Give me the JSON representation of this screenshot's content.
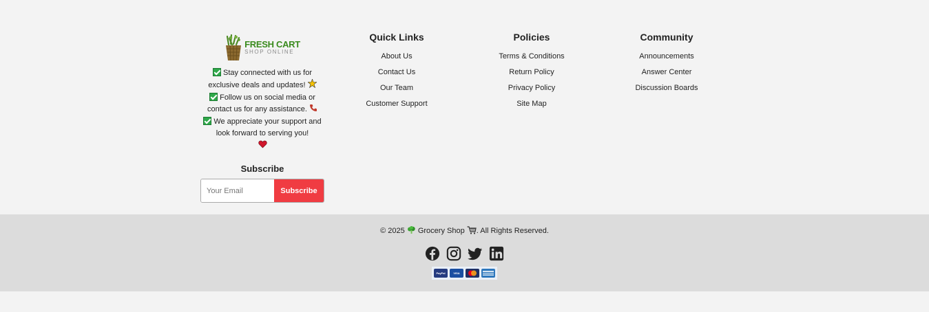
{
  "brand": {
    "logo_line1": "FRESH CART",
    "logo_line2": "SHOP ONLINE",
    "intro": [
      {
        "text": "Stay connected with us for exclusive deals and updates!",
        "emoji": "sparkle-icon"
      },
      {
        "text": "Follow us on social media or contact us for any assistance.",
        "emoji": "phone-icon"
      },
      {
        "text": "We appreciate your support and look forward to serving you!",
        "emoji": "heart-icon"
      }
    ]
  },
  "subscribe": {
    "title": "Subscribe",
    "placeholder": "Your Email",
    "button_label": "Subscribe",
    "button_color": "#f03c42"
  },
  "quick_links": {
    "title": "Quick Links",
    "items": [
      "About Us",
      "Contact Us",
      "Our Team",
      "Customer Support"
    ]
  },
  "policies": {
    "title": "Policies",
    "items": [
      "Terms & Conditions",
      "Return Policy",
      "Privacy Policy",
      "Site Map"
    ]
  },
  "community": {
    "title": "Community",
    "items": [
      "Announcements",
      "Answer Center",
      "Discussion Boards"
    ]
  },
  "bottom": {
    "copyright_prefix": "© 2025",
    "copyright_name": "Grocery Shop",
    "copyright_suffix": ". All Rights Reserved.",
    "social": [
      "facebook-icon",
      "instagram-icon",
      "twitter-icon",
      "linkedin-icon"
    ],
    "payments": [
      {
        "name": "PayPal",
        "color": "#253b80"
      },
      {
        "name": "VISA",
        "color": "#1a4ea1"
      },
      {
        "name": "mastercard",
        "color": "#1f2f63"
      },
      {
        "name": "AMERICAN EXPRESS",
        "color": "#2e77bc"
      }
    ]
  },
  "colors": {
    "top_bg": "#f3f3f3",
    "bottom_bg": "#dcdcdc",
    "brand_green": "#3a8b1e"
  }
}
